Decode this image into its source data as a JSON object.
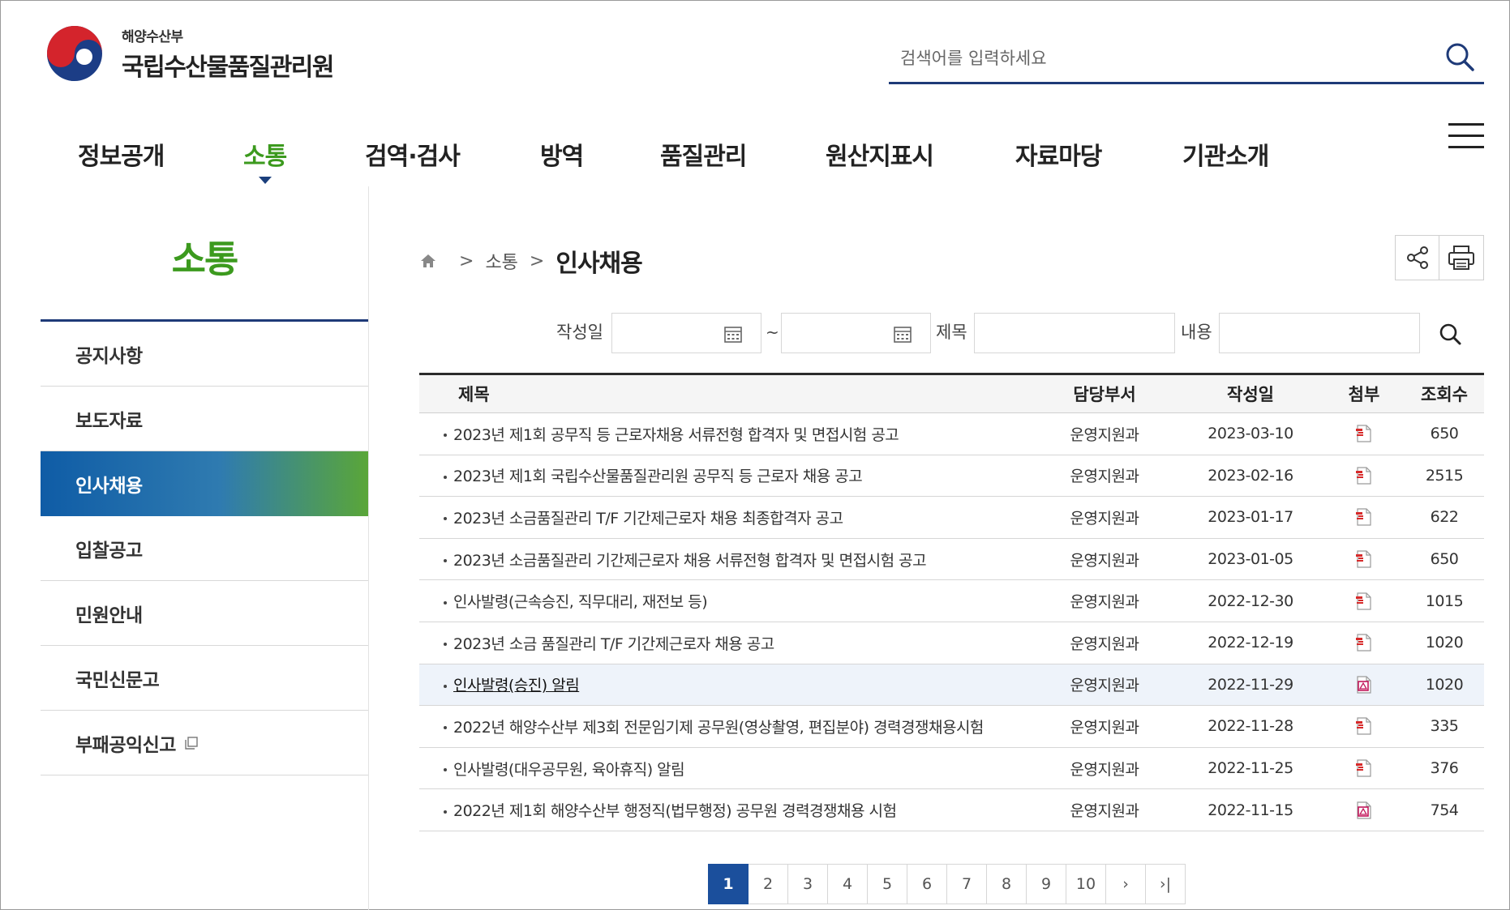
{
  "header": {
    "logo_sub": "해양수산부",
    "logo_main": "국립수산물품질관리원",
    "search_placeholder": "검색어를 입력하세요"
  },
  "gnb": [
    {
      "label": "정보공개",
      "active": false
    },
    {
      "label": "소통",
      "active": true
    },
    {
      "label": "검역·검사",
      "active": false
    },
    {
      "label": "방역",
      "active": false
    },
    {
      "label": "품질관리",
      "active": false
    },
    {
      "label": "원산지표시",
      "active": false
    },
    {
      "label": "자료마당",
      "active": false
    },
    {
      "label": "기관소개",
      "active": false
    }
  ],
  "lnb": {
    "title": "소통",
    "items": [
      {
        "label": "공지사항"
      },
      {
        "label": "보도자료"
      },
      {
        "label": "인사채용"
      },
      {
        "label": "입찰공고"
      },
      {
        "label": "민원안내"
      },
      {
        "label": "국민신문고"
      },
      {
        "label": "부패공익신고"
      }
    ]
  },
  "breadcrumb": {
    "parent": "소통",
    "current": "인사채용"
  },
  "filter": {
    "date_label": "작성일",
    "tilde": "~",
    "title_label": "제목",
    "content_label": "내용"
  },
  "table": {
    "headers": {
      "title": "제목",
      "dept": "담당부서",
      "date": "작성일",
      "attach": "첨부",
      "views": "조회수"
    },
    "rows": [
      {
        "title": "2023년 제1회 공무직 등 근로자채용 서류전형 합격자 및 면접시험 공고",
        "dept": "운영지원과",
        "date": "2023-03-10",
        "file": "hwp",
        "views": "650"
      },
      {
        "title": "2023년 제1회 국립수산물품질관리원 공무직 등 근로자 채용 공고",
        "dept": "운영지원과",
        "date": "2023-02-16",
        "file": "hwp",
        "views": "2515"
      },
      {
        "title": "2023년 소금품질관리 T/F 기간제근로자 채용 최종합격자 공고",
        "dept": "운영지원과",
        "date": "2023-01-17",
        "file": "hwp",
        "views": "622"
      },
      {
        "title": "2023년 소금품질관리 기간제근로자 채용 서류전형 합격자 및 면접시험 공고",
        "dept": "운영지원과",
        "date": "2023-01-05",
        "file": "hwp",
        "views": "650"
      },
      {
        "title": "인사발령(근속승진, 직무대리, 재전보 등)",
        "dept": "운영지원과",
        "date": "2022-12-30",
        "file": "hwp",
        "views": "1015"
      },
      {
        "title": "2023년 소금 품질관리 T/F 기간제근로자 채용 공고",
        "dept": "운영지원과",
        "date": "2022-12-19",
        "file": "hwp",
        "views": "1020"
      },
      {
        "title": "인사발령(승진) 알림",
        "dept": "운영지원과",
        "date": "2022-11-29",
        "file": "pdf",
        "views": "1020"
      },
      {
        "title": "2022년 해양수산부 제3회 전문임기제 공무원(영상촬영, 편집분야) 경력경쟁채용시험",
        "dept": "운영지원과",
        "date": "2022-11-28",
        "file": "hwp",
        "views": "335"
      },
      {
        "title": "인사발령(대우공무원, 육아휴직) 알림",
        "dept": "운영지원과",
        "date": "2022-11-25",
        "file": "hwp",
        "views": "376"
      },
      {
        "title": "2022년 제1회 해양수산부 행정직(법무행정) 공무원 경력경쟁채용 시험",
        "dept": "운영지원과",
        "date": "2022-11-15",
        "file": "pdf",
        "views": "754"
      }
    ]
  },
  "pagination": {
    "pages": [
      "1",
      "2",
      "3",
      "4",
      "5",
      "6",
      "7",
      "8",
      "9",
      "10"
    ],
    "current": "1",
    "next": "›",
    "last": "›|"
  },
  "colors": {
    "brand_navy": "#1e3a78",
    "accent_green": "#3c9a1e",
    "page_active": "#1b4f9c"
  }
}
